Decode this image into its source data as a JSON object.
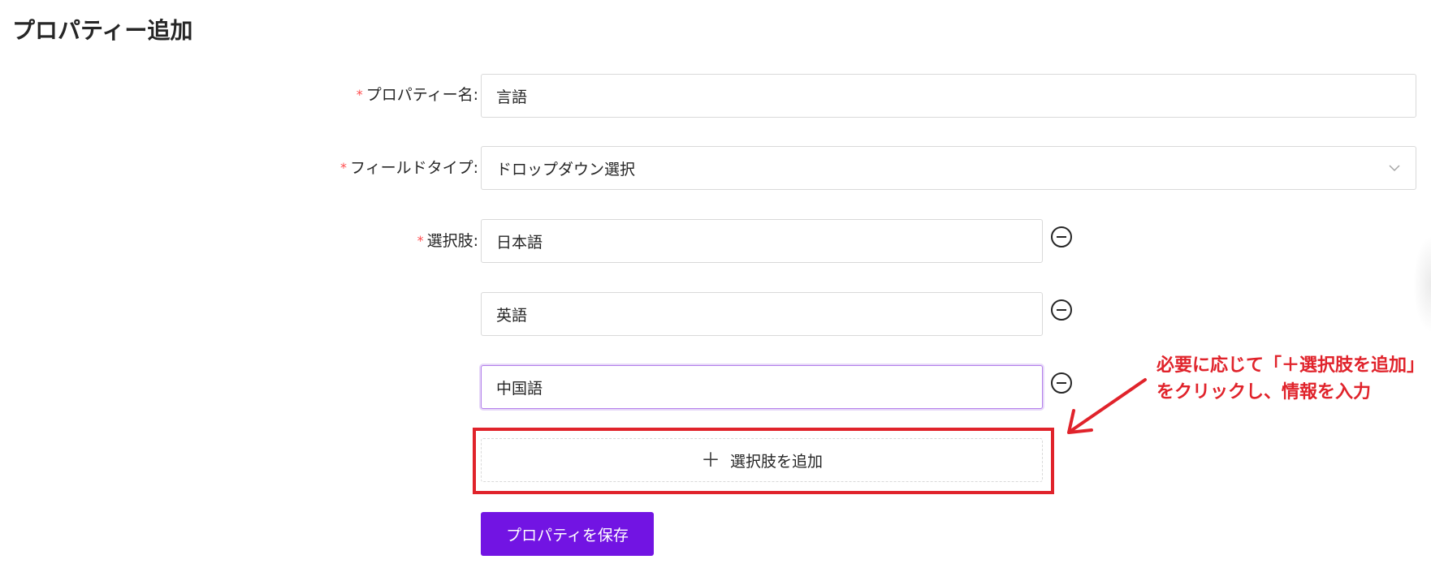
{
  "page": {
    "title": "プロパティー追加"
  },
  "form": {
    "required_mark": "*",
    "property_name": {
      "label": "プロパティー名:",
      "value": "言語"
    },
    "field_type": {
      "label": "フィールドタイプ:",
      "value": "ドロップダウン選択",
      "icon": "chevron-down-icon"
    },
    "options": {
      "label": "選択肢:",
      "items": [
        {
          "value": "日本語"
        },
        {
          "value": "英語"
        },
        {
          "value": "中国語"
        }
      ],
      "remove_icon": "minus-circle-icon",
      "add_button": {
        "icon": "＋",
        "label": "選択肢を追加"
      }
    },
    "save_button": {
      "label": "プロパティを保存"
    }
  },
  "annotation": {
    "text": "必要に応じて「＋選択肢を追加」をクリックし、情報を入力"
  },
  "colors": {
    "primary": "#7214e3",
    "required": "#ff4d4f",
    "annotation": "#e0232b",
    "focus_border": "#b37feb"
  }
}
